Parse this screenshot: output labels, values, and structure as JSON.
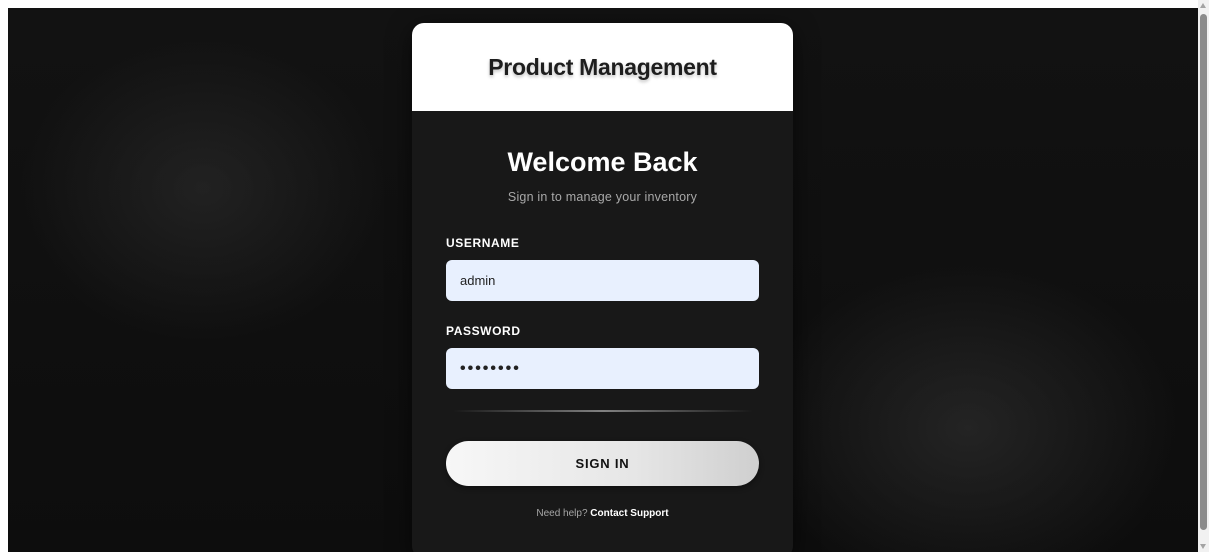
{
  "header": {
    "title": "Product Management"
  },
  "login": {
    "heading": "Welcome Back",
    "subtitle": "Sign in to manage your inventory",
    "username": {
      "label": "USERNAME",
      "value": "admin"
    },
    "password": {
      "label": "PASSWORD",
      "value": "••••••••"
    },
    "submit_label": "SIGN IN",
    "help_text": "Need help?",
    "help_link": "Contact Support"
  },
  "colors": {
    "page_background": "#0f0f0f",
    "card_background": "#181818",
    "header_background": "#ffffff",
    "input_background": "#e8f0fe",
    "button_gradient_start": "#f7f7f7",
    "button_gradient_end": "#cfcfcf"
  }
}
